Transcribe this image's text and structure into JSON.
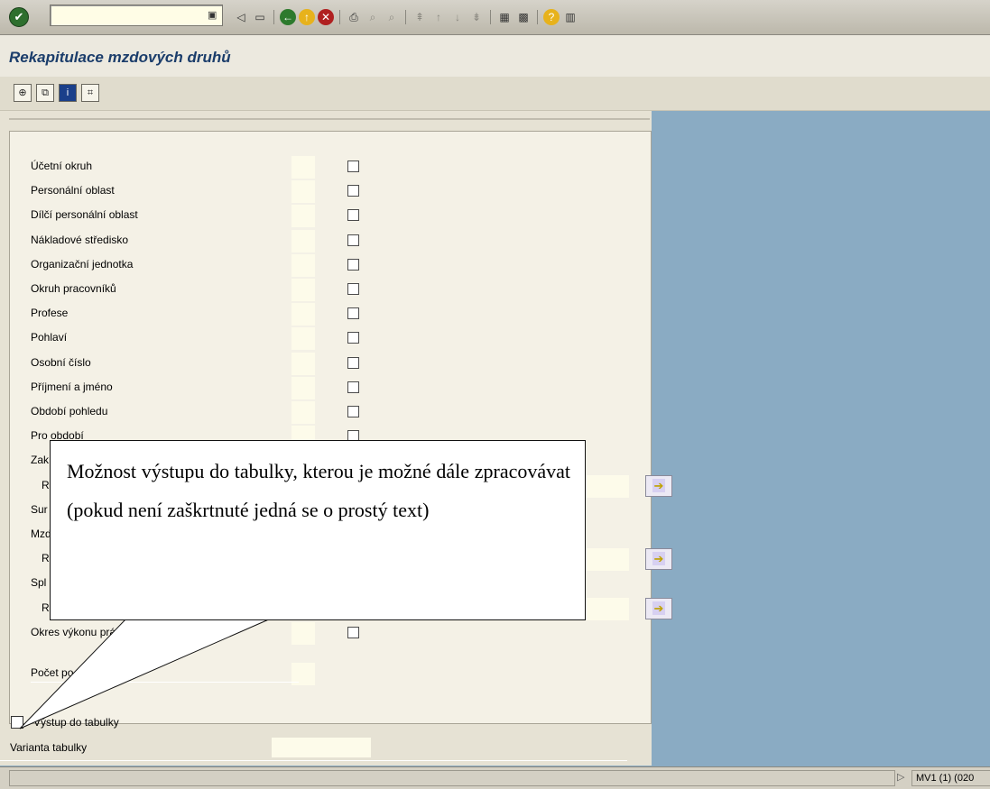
{
  "toolbar": {
    "command_value": "",
    "icons": [
      "ok-icon",
      "command-field-menu-icon",
      "back-arrow-icon",
      "save-icon",
      "back-icon",
      "exit-icon",
      "cancel-icon",
      "print-icon",
      "find-icon",
      "find-next-icon",
      "first-page-icon",
      "previous-page-icon",
      "next-page-icon",
      "last-page-icon",
      "create-session-icon",
      "shortcut-icon",
      "help-icon",
      "layout-icon"
    ]
  },
  "title": "Rekapitulace mzdových druhů",
  "app_toolbar": {
    "icons": [
      "execute-icon",
      "get-variant-icon",
      "info-icon",
      "selection-options-icon"
    ]
  },
  "form": {
    "rows": [
      {
        "label": "Účetní okruh"
      },
      {
        "label": "Personální oblast"
      },
      {
        "label": "Dílčí personální oblast"
      },
      {
        "label": "Nákladové středisko"
      },
      {
        "label": "Organizační jednotka"
      },
      {
        "label": "Okruh pracovníků"
      },
      {
        "label": "Profese"
      },
      {
        "label": "Pohlaví"
      },
      {
        "label": "Osobní číslo"
      },
      {
        "label": "Příjmení a jméno"
      },
      {
        "label": "Období pohledu"
      },
      {
        "label": "Pro období"
      },
      {
        "label": "Zak"
      },
      {
        "label": "Ro"
      },
      {
        "label": "Sur"
      },
      {
        "label": "Mzd"
      },
      {
        "label": "Ro"
      },
      {
        "label": "Spl"
      },
      {
        "label": "Ro"
      },
      {
        "label": "Okres výkonu prá"
      }
    ],
    "count_label": "Počet po"
  },
  "bottom": {
    "output_label": "Výstup do tabulky",
    "output_checked": false,
    "variant_label": "Varianta tabulky",
    "variant_value": ""
  },
  "status": {
    "message": "",
    "system": "MV1 (1) (020"
  },
  "callout": {
    "text": "Možnost výstupu do tabulky, kterou je možné dále zpracovávat (pokud není zaškrtnuté jedná se o prostý text)"
  }
}
